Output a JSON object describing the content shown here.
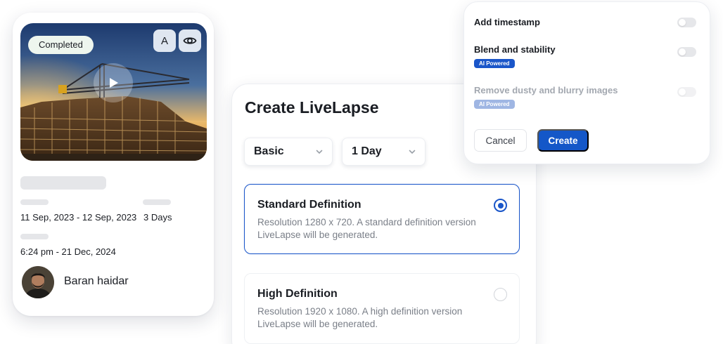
{
  "project_card": {
    "status": "Completed",
    "thumb_button_letter": "A",
    "icons": {
      "view": "eye-icon",
      "play": "play-icon"
    },
    "date_range": "11 Sep, 2023 - 12 Sep, 2023",
    "duration": "3 Days",
    "created_at": "6:24 pm - 21 Dec, 2024",
    "user_name": "Baran haidar"
  },
  "create_dialog": {
    "title": "Create LiveLapse",
    "type_select": "Basic",
    "duration_select": "1 Day",
    "options": [
      {
        "title": "Standard Definition",
        "description": "Resolution 1280 x 720. A standard definition version LiveLapse will be generated.",
        "selected": true
      },
      {
        "title": "High Definition",
        "description": "Resolution 1920 x 1080. A high definition version LiveLapse will be generated.",
        "selected": false
      }
    ]
  },
  "settings": {
    "items": [
      {
        "label": "Add timestamp",
        "badge": "",
        "enabled": true,
        "on": false
      },
      {
        "label": "Blend and stability",
        "badge": "AI Powered",
        "enabled": true,
        "on": false
      },
      {
        "label": "Remove dusty and blurry images",
        "badge": "AI Powered",
        "enabled": false,
        "on": false
      }
    ],
    "cancel_label": "Cancel",
    "create_label": "Create"
  },
  "colors": {
    "accent": "#1457C8",
    "status_pill_bg": "#EEF6EE"
  }
}
